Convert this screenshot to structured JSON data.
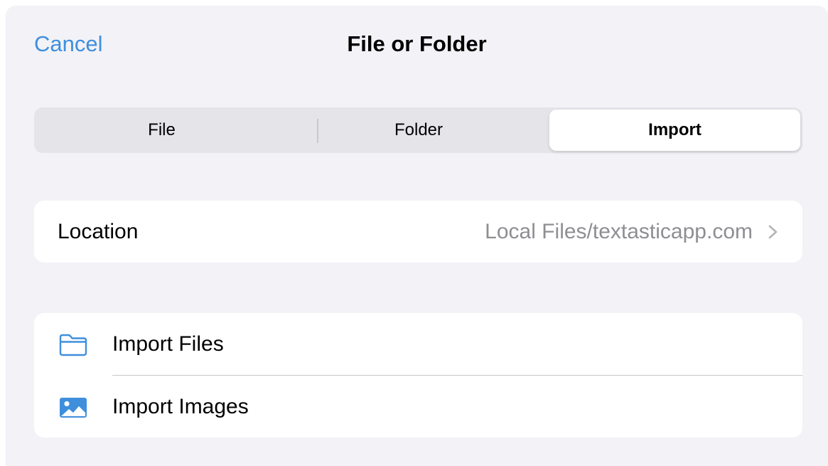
{
  "nav": {
    "cancel_label": "Cancel",
    "title": "File or Folder"
  },
  "segments": [
    {
      "label": "File",
      "selected": false
    },
    {
      "label": "Folder",
      "selected": false
    },
    {
      "label": "Import",
      "selected": true
    }
  ],
  "location": {
    "label": "Location",
    "value": "Local Files/textasticapp.com",
    "icon": "chevron-right-icon"
  },
  "import_options": [
    {
      "label": "Import Files",
      "icon": "folder-icon"
    },
    {
      "label": "Import Images",
      "icon": "photo-icon"
    }
  ],
  "colors": {
    "accent": "#3f8fdc",
    "background": "#f2f2f7",
    "secondary_text": "#8e8e93"
  }
}
